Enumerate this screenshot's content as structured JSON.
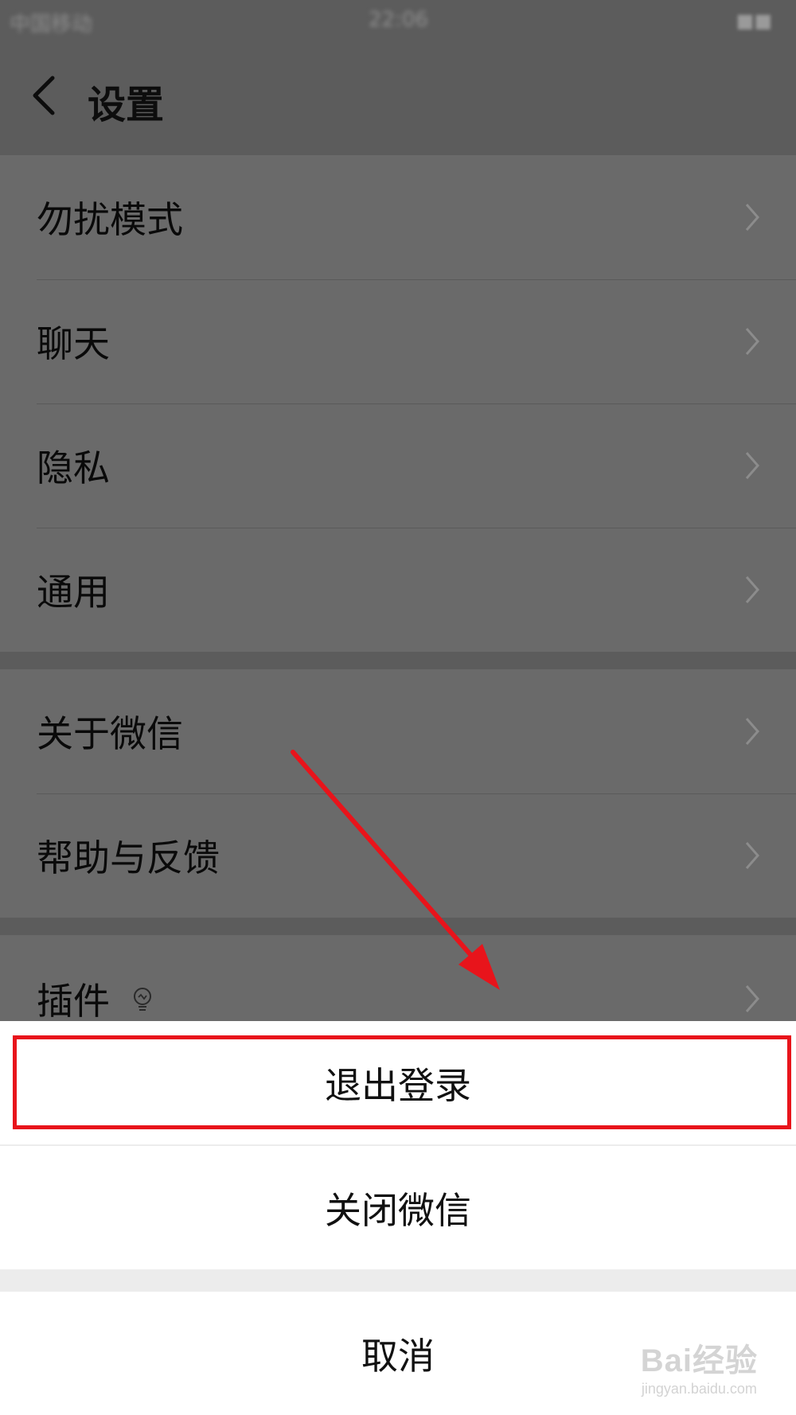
{
  "status_bar": {
    "carrier": "中国移动",
    "time": "22:06",
    "battery": "■■"
  },
  "header": {
    "title": "设置"
  },
  "settings_groups": [
    {
      "items": [
        {
          "label": "勿扰模式"
        },
        {
          "label": "聊天"
        },
        {
          "label": "隐私"
        },
        {
          "label": "通用"
        }
      ]
    },
    {
      "items": [
        {
          "label": "关于微信"
        },
        {
          "label": "帮助与反馈"
        }
      ]
    },
    {
      "items": [
        {
          "label": "插件",
          "icon": "lightbulb-icon"
        }
      ]
    }
  ],
  "action_sheet": {
    "logout_label": "退出登录",
    "close_label": "关闭微信",
    "cancel_label": "取消"
  },
  "annotation": {
    "color": "#e8141b"
  },
  "watermark": {
    "brand": "Bai经验",
    "url": "jingyan.baidu.com"
  }
}
